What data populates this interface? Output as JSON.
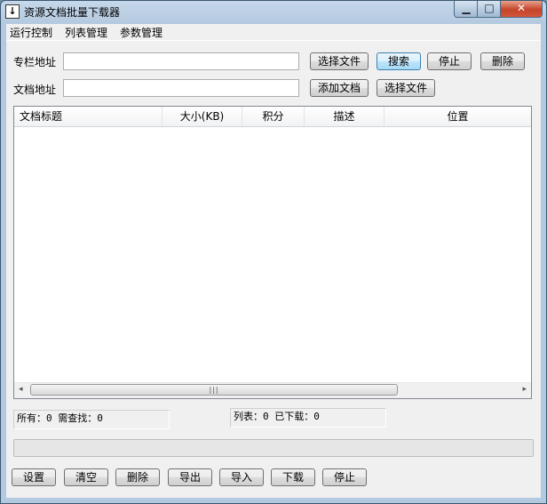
{
  "window": {
    "title": "资源文档批量下载器",
    "controls": [
      "minimize-icon",
      "maximize-icon",
      "close-icon"
    ]
  },
  "menu": [
    "运行控制",
    "列表管理",
    "参数管理"
  ],
  "form": {
    "column_label": "专栏地址",
    "column_value": "",
    "doc_label": "文档地址",
    "doc_value": "",
    "row1_buttons": [
      "选择文件",
      "搜索",
      "停止",
      "删除"
    ],
    "row2_buttons": [
      "添加文档",
      "选择文件"
    ]
  },
  "list": {
    "headers": [
      "文档标题",
      "大小(KB)",
      "积分",
      "描述",
      "位置"
    ],
    "rows": []
  },
  "status": {
    "left": "所有：0 需查找：0",
    "right": "列表：0 已下载：0"
  },
  "progress": {
    "value": 0
  },
  "bottom_buttons": [
    "设置",
    "清空",
    "删除",
    "导出",
    "导入",
    "下载",
    "停止"
  ]
}
